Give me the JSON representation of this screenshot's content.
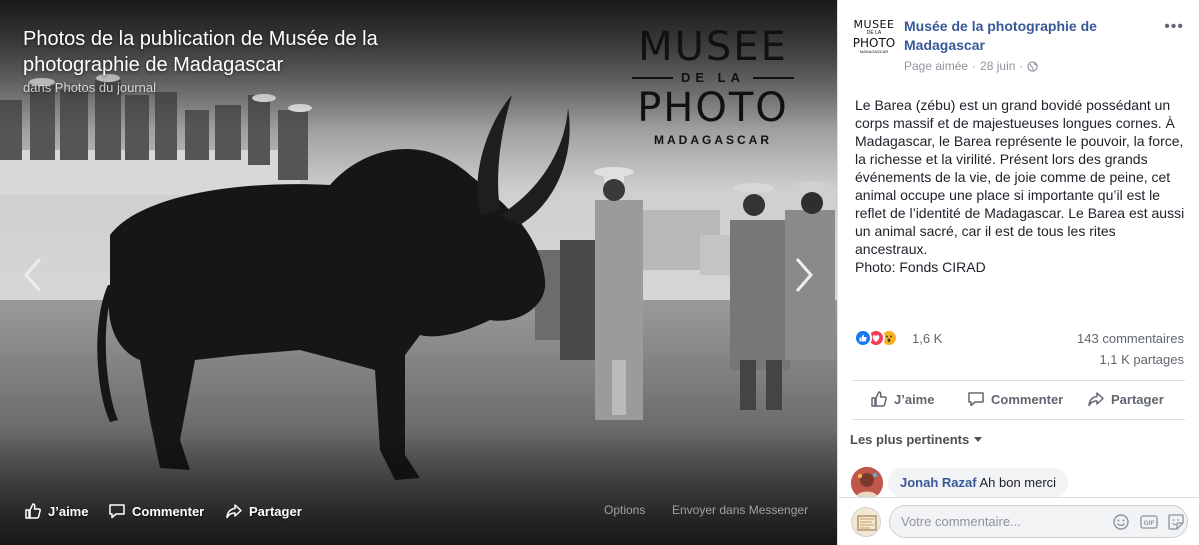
{
  "viewer": {
    "title": "Photos de la publication de Musée de la photographie de Madagascar",
    "subtitle": "dans Photos du journal",
    "logo": {
      "line1": "MUSEE",
      "line2": "DE LA",
      "line3": "PHOTO",
      "line4": "MADAGASCAR"
    },
    "actions": {
      "like": "J’aime",
      "comment": "Commenter",
      "share": "Partager"
    },
    "options_label": "Options",
    "messenger_label": "Envoyer dans Messenger"
  },
  "post": {
    "page_name": "Musée de la photographie de Madagascar",
    "page_status": "Page aimée",
    "date": "28 juin",
    "avatar": {
      "line1": "MUSEE",
      "line2": "DE LA",
      "line3": "PHOTO",
      "line4": "MADAGASCAR"
    },
    "more_label": "•••",
    "body": "Le Barea (zébu) est un grand bovidé possédant un corps massif et de majestueuses longues cornes. À Madagascar, le Barea représente le pouvoir, la force, la richesse et la virilité. Présent lors des grands événements de la vie, de joie comme de peine, cet animal occupe une place si importante qu’il est le reflet de l’identité de Madagascar. Le Barea est aussi un animal sacré, car il est de tous les rites ancestraux.",
    "credit": "Photo: Fonds CIRAD"
  },
  "stats": {
    "reactions": "1,6 K",
    "comments": "143 commentaires",
    "shares": "1,1 K partages"
  },
  "actions": {
    "like": "J’aime",
    "comment": "Commenter",
    "share": "Partager"
  },
  "comments": {
    "sort_label": "Les plus pertinents",
    "items": [
      {
        "author": "Jonah Razaf",
        "text": "Ah bon merci"
      }
    ],
    "composer_placeholder": "Votre commentaire...",
    "gif_label": "GIF"
  },
  "colors": {
    "link": "#385898",
    "like_blue": "#1877f2",
    "love_red": "#f33e58",
    "wow_yellow": "#f7b125"
  },
  "icons": [
    "chevron-left-icon",
    "chevron-right-icon",
    "thumbs-up-icon",
    "comment-icon",
    "share-icon",
    "globe-icon",
    "more-icon",
    "caret-down-icon",
    "smiley-icon",
    "gif-icon",
    "sticker-icon"
  ]
}
